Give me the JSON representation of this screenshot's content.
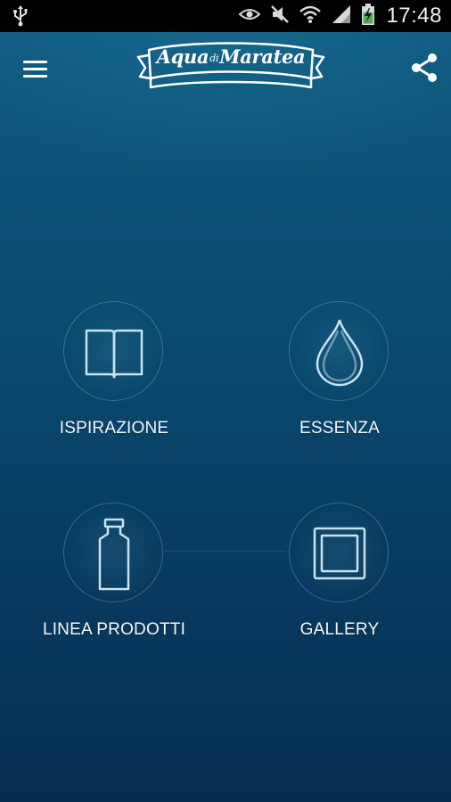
{
  "status_bar": {
    "time": "17:48",
    "icons": [
      "usb-icon",
      "eye-icon",
      "mute-icon",
      "wifi-icon",
      "signal-icon",
      "battery-charging-icon"
    ]
  },
  "header": {
    "logo": {
      "part1": "Aqua",
      "part2": "di",
      "part3": "Maratea"
    },
    "menu_icon": "hamburger-menu-icon",
    "share_icon": "share-icon"
  },
  "menu": [
    {
      "label": "ISPIRAZIONE",
      "icon": "book-icon"
    },
    {
      "label": "ESSENZA",
      "icon": "water-drop-icon"
    },
    {
      "label": "LINEA PRODOTTI",
      "icon": "bottle-icon"
    },
    {
      "label": "GALLERY",
      "icon": "gallery-frame-icon"
    }
  ],
  "colors": {
    "background_top": "#0f5a7f",
    "background_bottom": "#062d4e",
    "icon_stroke": "#c8e3ee",
    "text": "#f4f8fb"
  }
}
